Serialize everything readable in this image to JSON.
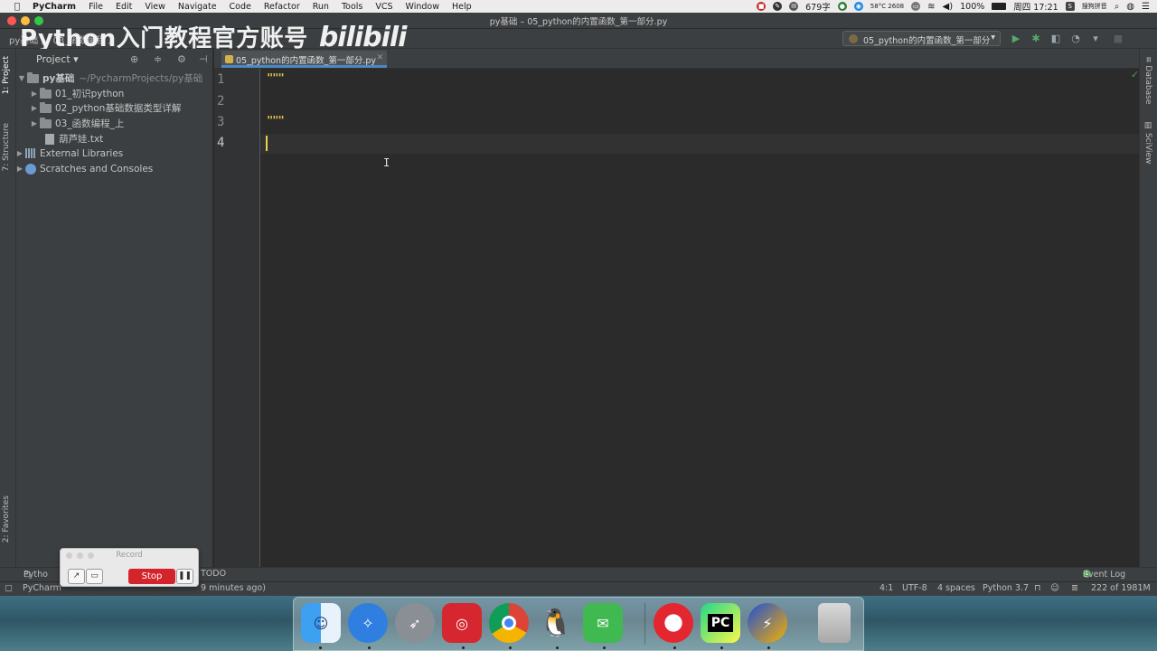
{
  "menubar": {
    "app_name": "PyCharm",
    "items": [
      "File",
      "Edit",
      "View",
      "Navigate",
      "Code",
      "Refactor",
      "Run",
      "Tools",
      "VCS",
      "Window",
      "Help"
    ],
    "word_count": "679字",
    "weather": "58°C 2608",
    "battery": "100%",
    "clock": "周四 17:21",
    "input_method": "搜狗拼音"
  },
  "window": {
    "title": "py基础 – 05_python的内置函数_第一部分.py"
  },
  "navbar": {
    "crumbs": "py基础  〉 03_函数编程  〉",
    "watermark_text": "Python入门教程官方账号",
    "watermark_logo": "bilibili",
    "run_config": "05_python的内置函数_第一部分"
  },
  "left_strip": {
    "project_tab": "1: Project",
    "structure_tab": "7: Structure",
    "favorites_tab": "2: Favorites"
  },
  "project_panel": {
    "header": "Project",
    "root_name": "py基础",
    "root_path": "~/PycharmProjects/py基础",
    "folders": [
      "01_初识python",
      "02_python基础数据类型详解",
      "03_函数编程_上"
    ],
    "file": "葫芦娃.txt",
    "external_libraries": "External Libraries",
    "scratches": "Scratches and Consoles"
  },
  "editor": {
    "tab_label": "05_python的内置函数_第一部分.py",
    "line_numbers": [
      "1",
      "2",
      "3",
      "4"
    ],
    "code_line_1": "\"\"\"",
    "code_line_3": "\"\"\""
  },
  "right_strip": {
    "database_tab": "Database",
    "sciview_tab": "SciView"
  },
  "bottom_tools": {
    "python_console": "Pytho",
    "todo": "TODO",
    "event_log": "Event Log"
  },
  "statusbar": {
    "message_start": "PyCharm",
    "message_end": "9 minutes ago)",
    "position": "4:1",
    "encoding": "UTF-8",
    "indent": "4 spaces",
    "interpreter": "Python 3.7",
    "memory": "222 of 1981M"
  },
  "record": {
    "title": "Record",
    "stop_label": "Stop"
  },
  "dock": {
    "pycharm_label": "PC"
  },
  "colors": {
    "editor_bg": "#2b2b2b",
    "panel_bg": "#3c3f41",
    "docstring": "#e5c14c",
    "stop_red": "#d3242b",
    "tab_underline": "#4a88c7"
  }
}
